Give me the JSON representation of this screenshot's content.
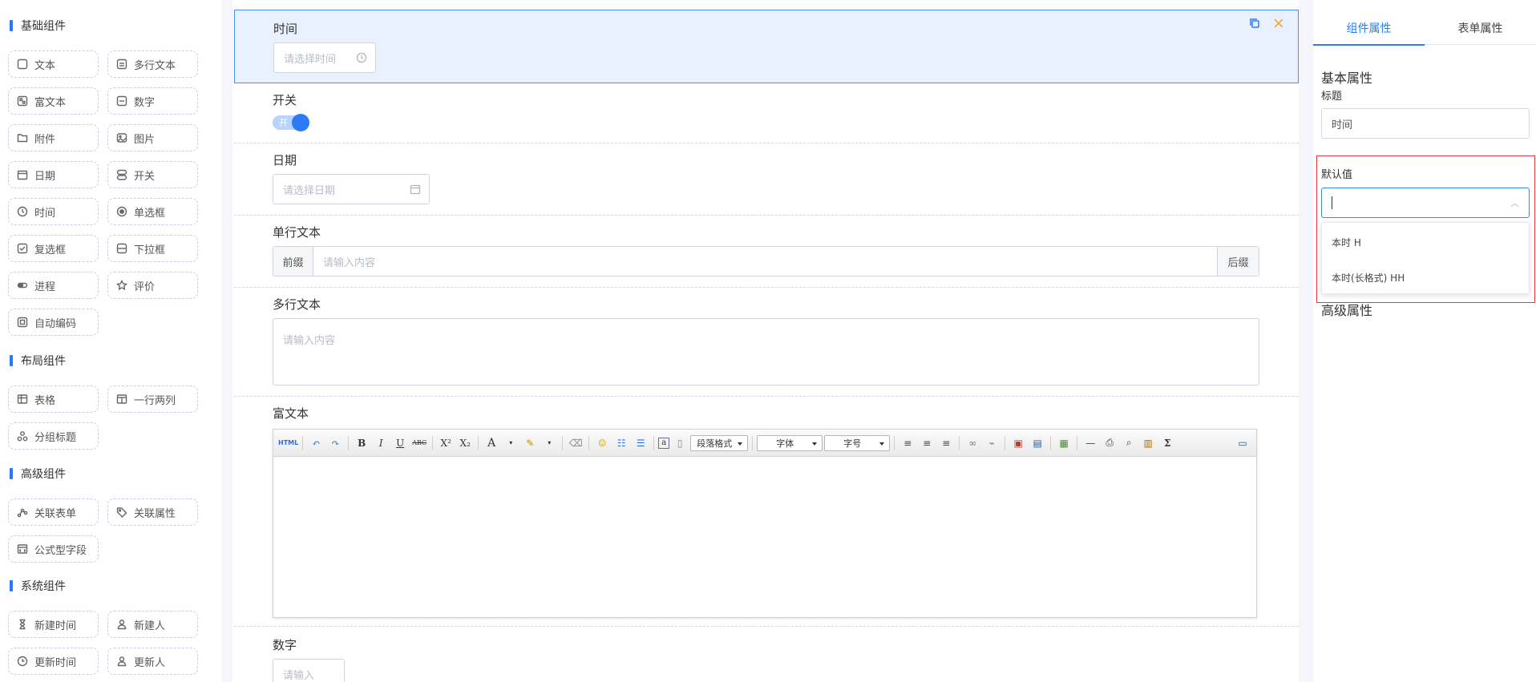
{
  "palette": {
    "groups": [
      {
        "title": "基础组件"
      },
      {
        "title": "布局组件"
      },
      {
        "title": "高级组件"
      },
      {
        "title": "系统组件"
      }
    ],
    "basic": [
      "文本",
      "多行文本",
      "富文本",
      "数字",
      "附件",
      "图片",
      "日期",
      "开关",
      "时间",
      "单选框",
      "复选框",
      "下拉框",
      "进程",
      "评价",
      "自动编码"
    ],
    "layout": [
      "表格",
      "一行两列",
      "分组标题"
    ],
    "advanced": [
      "关联表单",
      "关联属性",
      "公式型字段"
    ],
    "system": [
      "新建时间",
      "新建人",
      "更新时间",
      "更新人"
    ]
  },
  "canvas": {
    "time": {
      "label": "时间",
      "placeholder": "请选择时间"
    },
    "switch": {
      "label": "开关",
      "on_text": "开"
    },
    "date": {
      "label": "日期",
      "placeholder": "请选择日期"
    },
    "single_text": {
      "label": "单行文本",
      "prefix": "前缀",
      "placeholder": "请输入内容",
      "suffix": "后缀"
    },
    "multi_text": {
      "label": "多行文本",
      "placeholder": "请输入内容"
    },
    "rich_text": {
      "label": "富文本",
      "toolbar": {
        "html": "HTML",
        "paragraph": "段落格式",
        "font": "字体",
        "size": "字号",
        "sigma": "Σ",
        "bold": "B",
        "italic": "I",
        "underline": "U",
        "strike": "ABC",
        "sup": "X²",
        "sub": "X₂",
        "forecolor": "A",
        "a": "a"
      }
    },
    "number": {
      "label": "数字",
      "placeholder": "请输入"
    }
  },
  "panel": {
    "tabs": [
      "组件属性",
      "表单属性"
    ],
    "basic_title": "基本属性",
    "title_label": "标题",
    "title_value": "时间",
    "default_label": "默认值",
    "options": [
      "本时 H",
      "本时(长格式) HH"
    ],
    "advanced_title": "高级属性"
  },
  "colors": {
    "accent": "#2a7ef3",
    "highlight": "#e4393c",
    "active_bg": "#e9f1fe"
  }
}
